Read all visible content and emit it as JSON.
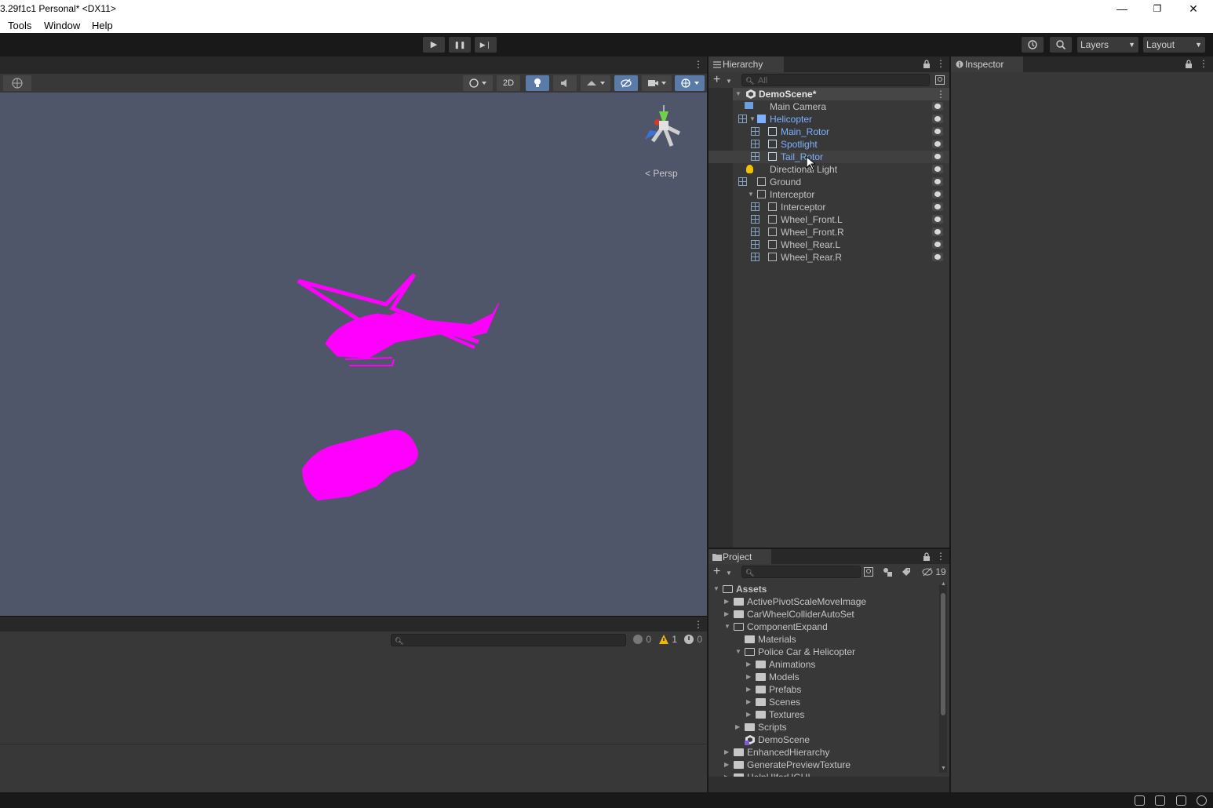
{
  "window": {
    "title": "3.29f1c1 Personal* <DX11>",
    "minimize": "—",
    "maximize": "❐",
    "close": "✕"
  },
  "menu": [
    "Tools",
    "Window",
    "Help"
  ],
  "toolbar": {
    "play": "▶",
    "pause": "❚❚",
    "step": "▶❘",
    "layers_label": "Layers",
    "layout_label": "Layout"
  },
  "scene": {
    "toggle_2d": "2D",
    "persp_label": "< Persp"
  },
  "console": {
    "count_info": "0",
    "count_warn": "1",
    "count_error": "0"
  },
  "hierarchy": {
    "tab": "Hierarchy",
    "search_placeholder": "All",
    "scene_name": "DemoScene*",
    "items": [
      {
        "label": "Main Camera",
        "depth": 1
      },
      {
        "label": "Helicopter",
        "depth": 1
      },
      {
        "label": "Main_Rotor",
        "depth": 2
      },
      {
        "label": "Spotlight",
        "depth": 2
      },
      {
        "label": "Tail_Rotor",
        "depth": 2
      },
      {
        "label": "Directional Light",
        "depth": 1
      },
      {
        "label": "Ground",
        "depth": 1
      },
      {
        "label": "Interceptor",
        "depth": 1
      },
      {
        "label": "Interceptor",
        "depth": 2
      },
      {
        "label": "Wheel_Front.L",
        "depth": 2
      },
      {
        "label": "Wheel_Front.R",
        "depth": 2
      },
      {
        "label": "Wheel_Rear.L",
        "depth": 2
      },
      {
        "label": "Wheel_Rear.R",
        "depth": 2
      }
    ]
  },
  "project": {
    "tab": "Project",
    "hidden_count": "19",
    "items": [
      {
        "label": "Assets",
        "depth": 0
      },
      {
        "label": "ActivePivotScaleMoveImage",
        "depth": 1
      },
      {
        "label": "CarWheelColliderAutoSet",
        "depth": 1
      },
      {
        "label": "ComponentExpand",
        "depth": 1
      },
      {
        "label": "Materials",
        "depth": 2
      },
      {
        "label": "Police Car & Helicopter",
        "depth": 2
      },
      {
        "label": "Animations",
        "depth": 3
      },
      {
        "label": "Models",
        "depth": 3
      },
      {
        "label": "Prefabs",
        "depth": 3
      },
      {
        "label": "Scenes",
        "depth": 3
      },
      {
        "label": "Textures",
        "depth": 3
      },
      {
        "label": "Scripts",
        "depth": 2
      },
      {
        "label": "DemoScene",
        "depth": 2
      },
      {
        "label": "EnhancedHierarchy",
        "depth": 1
      },
      {
        "label": "GeneratePreviewTexture",
        "depth": 1
      },
      {
        "label": "HelpUIforUGUI",
        "depth": 1
      }
    ]
  },
  "inspector": {
    "tab": "Inspector"
  },
  "colors": {
    "accent_blue": "#7fb0ff",
    "magenta": "#ff00ff",
    "panel": "#383838"
  }
}
